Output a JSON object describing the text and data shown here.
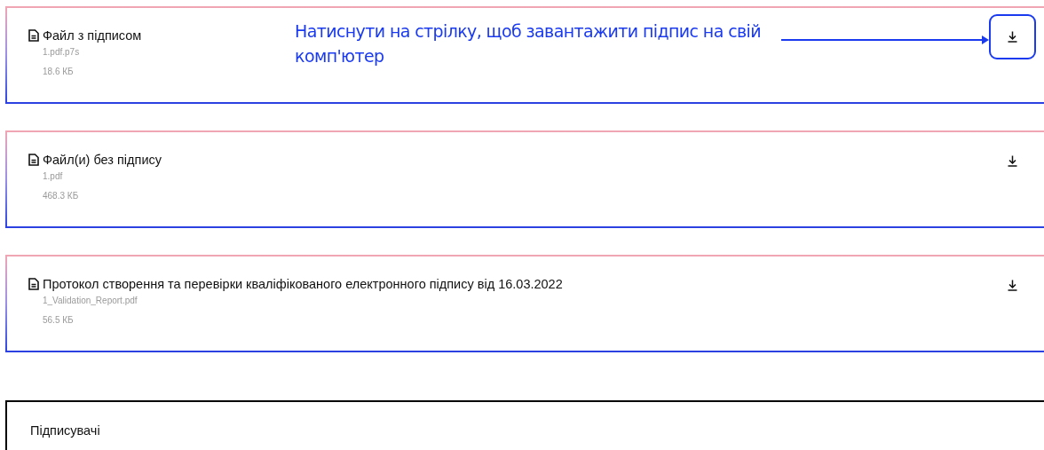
{
  "files": [
    {
      "title": "Файл з підписом",
      "filename": "1.pdf.p7s",
      "size": "18.6 КБ",
      "highlighted": true
    },
    {
      "title": "Файл(и) без підпису",
      "filename": "1.pdf",
      "size": "468.3 КБ",
      "highlighted": false
    },
    {
      "title": "Протокол створення та перевірки кваліфікованого електронного підпису від 16.03.2022",
      "filename": "1_Validation_Report.pdf",
      "size": "56.5 КБ",
      "highlighted": false
    }
  ],
  "annotation": {
    "text": "Натиснути на стрілку, щоб завантажити підпис на свій комп'ютер"
  },
  "signers": {
    "title": "Підписувачі"
  }
}
